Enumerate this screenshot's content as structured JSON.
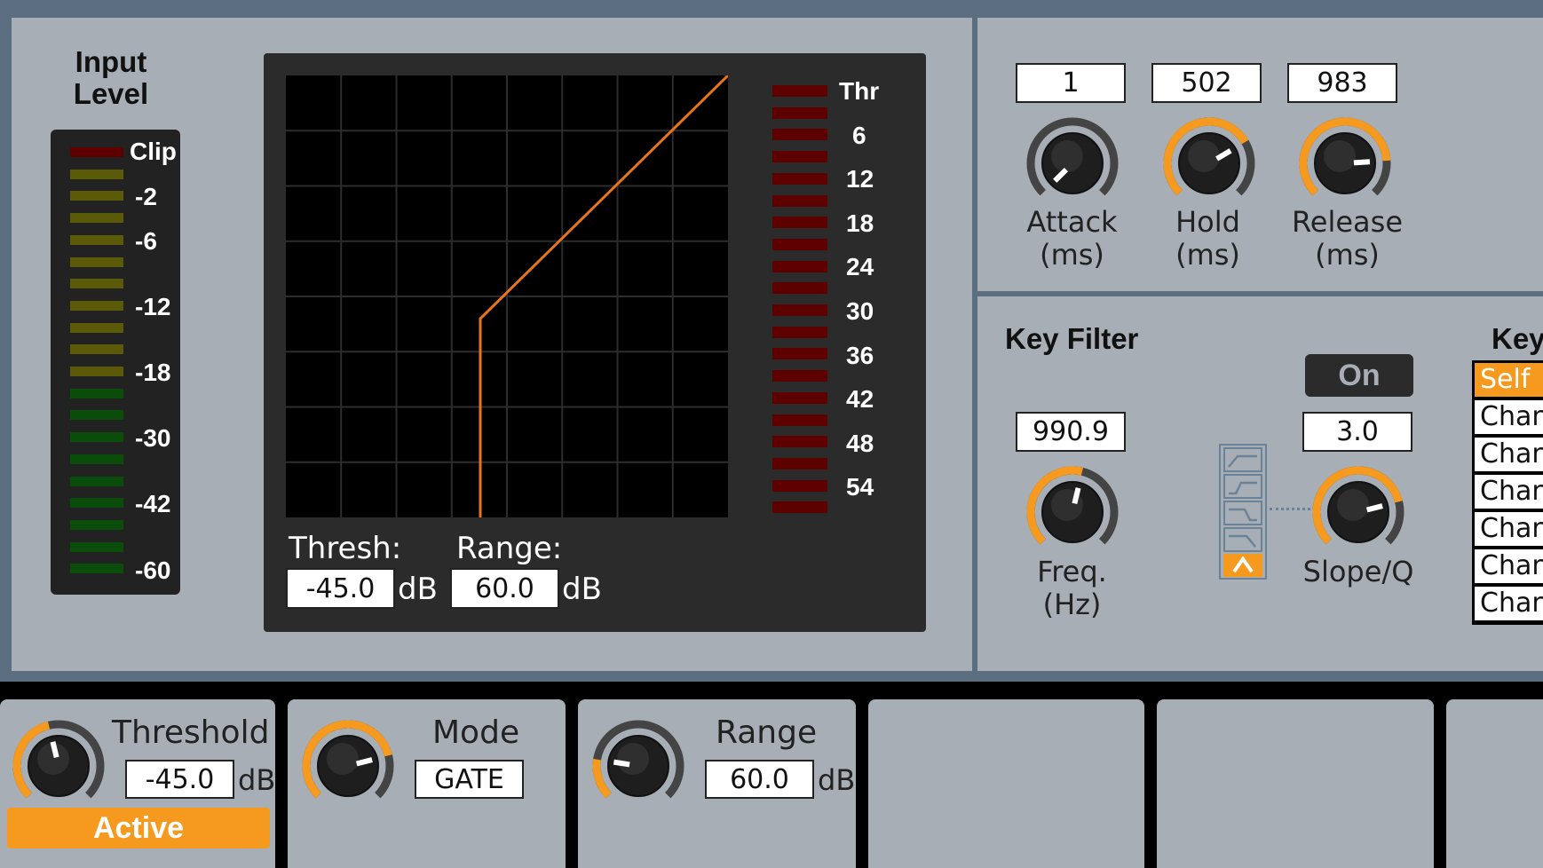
{
  "colors": {
    "accent": "#f59a1e",
    "panel": "#a7aeb5",
    "frame": "#5c6f80",
    "curve": "#e8741c"
  },
  "meter": {
    "title_line1": "Input",
    "title_line2": "Level",
    "labels": [
      "Clip",
      "-2",
      "-6",
      "-12",
      "-18",
      "-30",
      "-42",
      "-60"
    ]
  },
  "graph": {
    "scale_labels": [
      "Thr",
      "6",
      "12",
      "18",
      "24",
      "30",
      "36",
      "42",
      "48",
      "54"
    ],
    "thresh_label": "Thresh:",
    "thresh_value": "-45.0",
    "thresh_unit": "dB",
    "range_label": "Range:",
    "range_value": "60.0",
    "range_unit": "dB"
  },
  "envelope": {
    "attack": {
      "value": "1",
      "line1": "Attack",
      "line2": "(ms)"
    },
    "hold": {
      "value": "502",
      "line1": "Hold",
      "line2": "(ms)"
    },
    "release": {
      "value": "983",
      "line1": "Release",
      "line2": "(ms)"
    }
  },
  "key_filter": {
    "title": "Key Filter",
    "on_label": "On",
    "freq_value": "990.9",
    "freq_line1": "Freq.",
    "freq_line2": "(Hz)",
    "slope_value": "3.0",
    "slope_label": "Slope/Q",
    "filter_icons": [
      "high-pass-icon",
      "low-shelf-icon",
      "high-shelf-icon",
      "low-pass-icon",
      "bandpass-icon"
    ]
  },
  "key_source": {
    "title": "Key",
    "items": [
      "Self",
      "Chan",
      "Chan",
      "Chan",
      "Chan",
      "Chan",
      "Chan"
    ]
  },
  "bottom": {
    "threshold": {
      "title": "Threshold",
      "value": "-45.0",
      "unit": "dB",
      "status": "Active"
    },
    "mode": {
      "title": "Mode",
      "value": "GATE"
    },
    "range": {
      "title": "Range",
      "value": "60.0",
      "unit": "dB"
    }
  }
}
